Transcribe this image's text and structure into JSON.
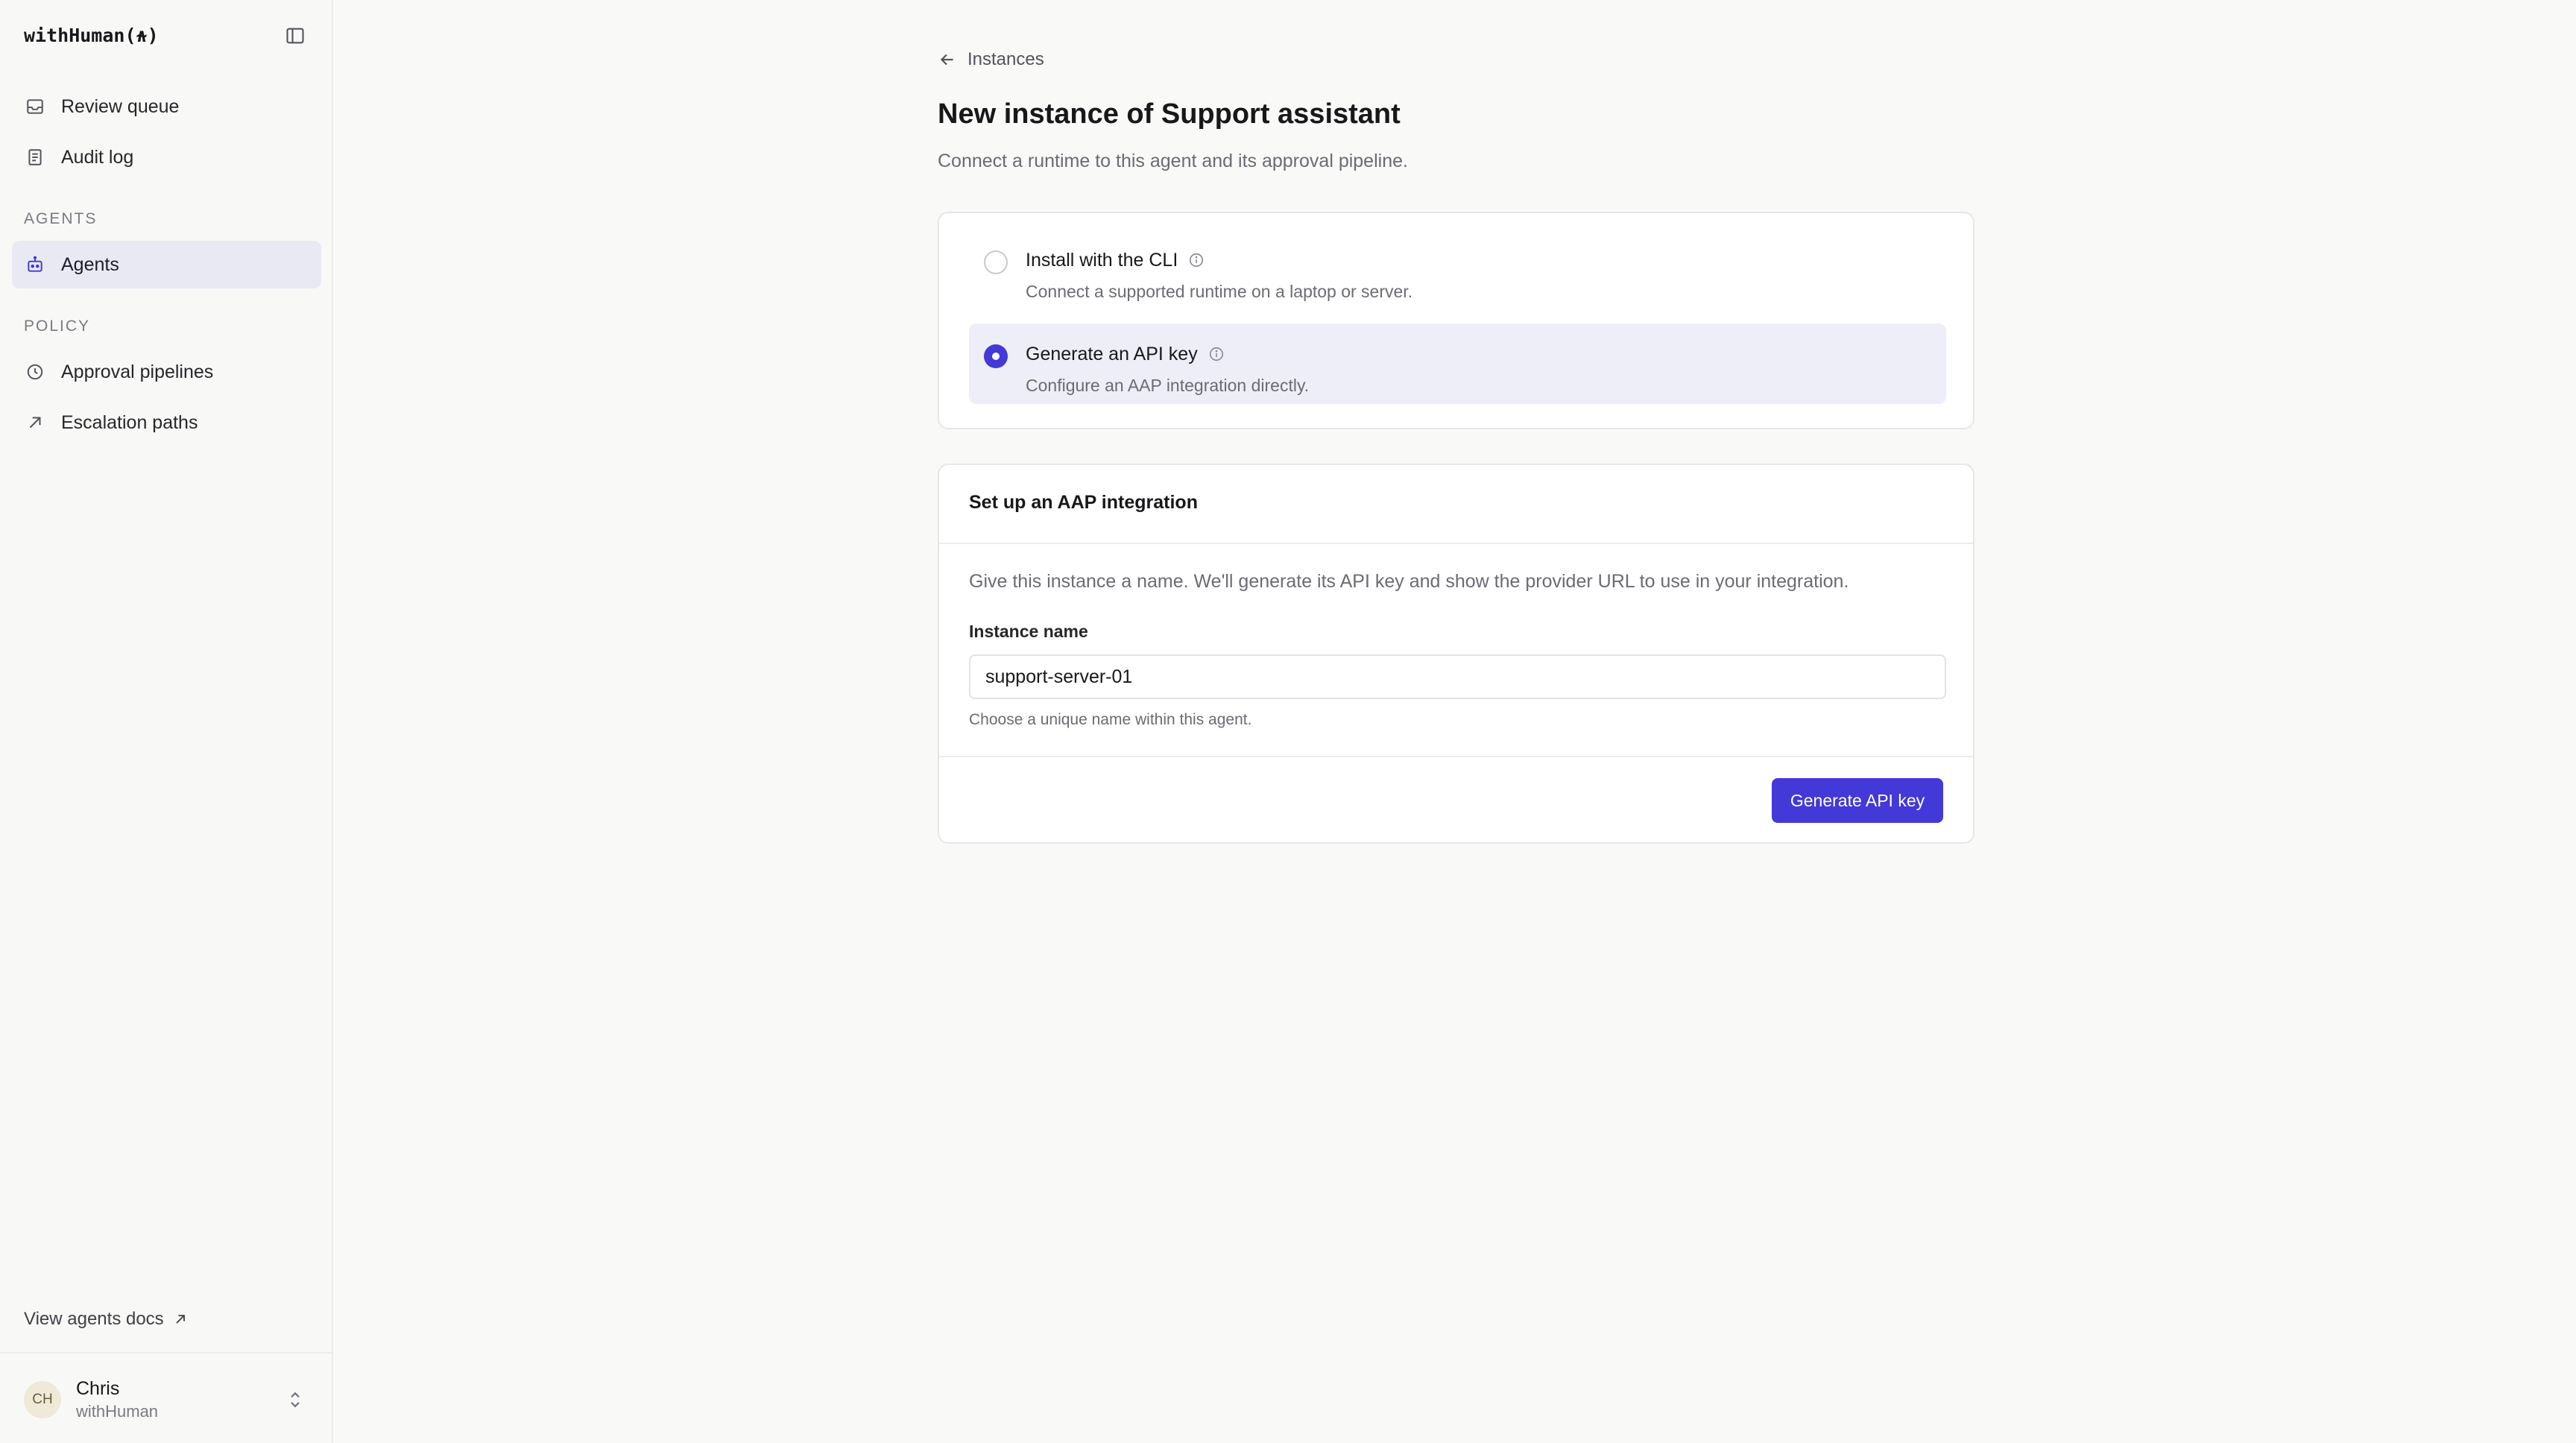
{
  "sidebar": {
    "brand": "withHuman(⍲)",
    "nav_top": [
      {
        "label": "Review queue",
        "icon": "inbox-icon"
      },
      {
        "label": "Audit log",
        "icon": "document-icon"
      }
    ],
    "sections": [
      {
        "label": "AGENTS",
        "items": [
          {
            "label": "Agents",
            "icon": "robot-icon",
            "active": true
          }
        ]
      },
      {
        "label": "POLICY",
        "items": [
          {
            "label": "Approval pipelines",
            "icon": "clock-icon"
          },
          {
            "label": "Escalation paths",
            "icon": "arrow-up-right-icon"
          }
        ]
      }
    ],
    "docs_link": "View agents docs",
    "user": {
      "initials": "CH",
      "name": "Chris",
      "org": "withHuman"
    }
  },
  "main": {
    "back_link": "Instances",
    "title": "New instance of Support assistant",
    "subtitle": "Connect a runtime to this agent and its approval pipeline.",
    "options": [
      {
        "title": "Install with the CLI",
        "desc": "Connect a supported runtime on a laptop or server.",
        "selected": false
      },
      {
        "title": "Generate an API key",
        "desc": "Configure an AAP integration directly.",
        "selected": true
      }
    ],
    "setup": {
      "title": "Set up an AAP integration",
      "description": "Give this instance a name. We'll generate its API key and show the provider URL to use in your integration.",
      "field_label": "Instance name",
      "field_value": "support-server-01",
      "field_hint": "Choose a unique name within this agent.",
      "button_label": "Generate API key"
    }
  },
  "colors": {
    "accent": "#4338d8",
    "active_nav_bg": "#e9e9f4",
    "selected_option_bg": "#eeeef8"
  }
}
